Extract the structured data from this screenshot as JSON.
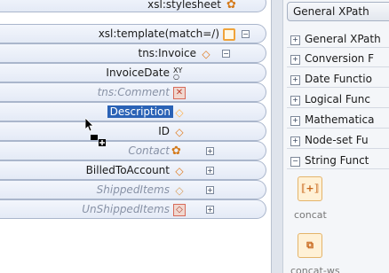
{
  "tree": {
    "stylesheet": "xsl:stylesheet",
    "template": "xsl:template(match=/)",
    "invoice": "tns:Invoice",
    "invoice_date": "InvoiceDate",
    "comment": "tns:Comment",
    "description": "Description",
    "id": "ID",
    "contact": "Contact",
    "billed_to_account": "BilledToAccount",
    "shipped_items": "ShippedItems",
    "unshipped_items": "UnShippedItems"
  },
  "palette": {
    "tab_title": "General XPath",
    "categories": [
      "General XPath",
      "Conversion F",
      "Date Functio",
      "Logical Func",
      "Mathematica",
      "Node-set Fu",
      "String Funct"
    ],
    "functions": [
      "concat",
      "concat-ws"
    ],
    "expand_symbol": "+",
    "collapse_symbol": "−"
  }
}
